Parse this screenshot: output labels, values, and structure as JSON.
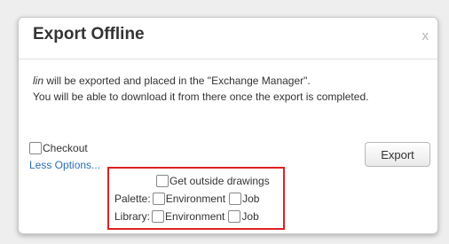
{
  "dialog": {
    "title": "Export Offline",
    "close_label": "x",
    "message": {
      "name": "lin",
      "line1_rest": " will be exported and placed in the \"Exchange Manager\".",
      "line2": "You will be able to download it from there once the export is completed."
    },
    "checkout_label": "Checkout",
    "less_options_label": "Less Options...",
    "export_label": "Export",
    "options": {
      "get_outside_drawings_label": "Get outside drawings",
      "palette_label": "Palette:",
      "library_label": "Library:",
      "environment_label": "Environment",
      "job_label": "Job"
    }
  },
  "colors": {
    "highlight_border": "#e02020",
    "link": "#2a6fb3"
  }
}
